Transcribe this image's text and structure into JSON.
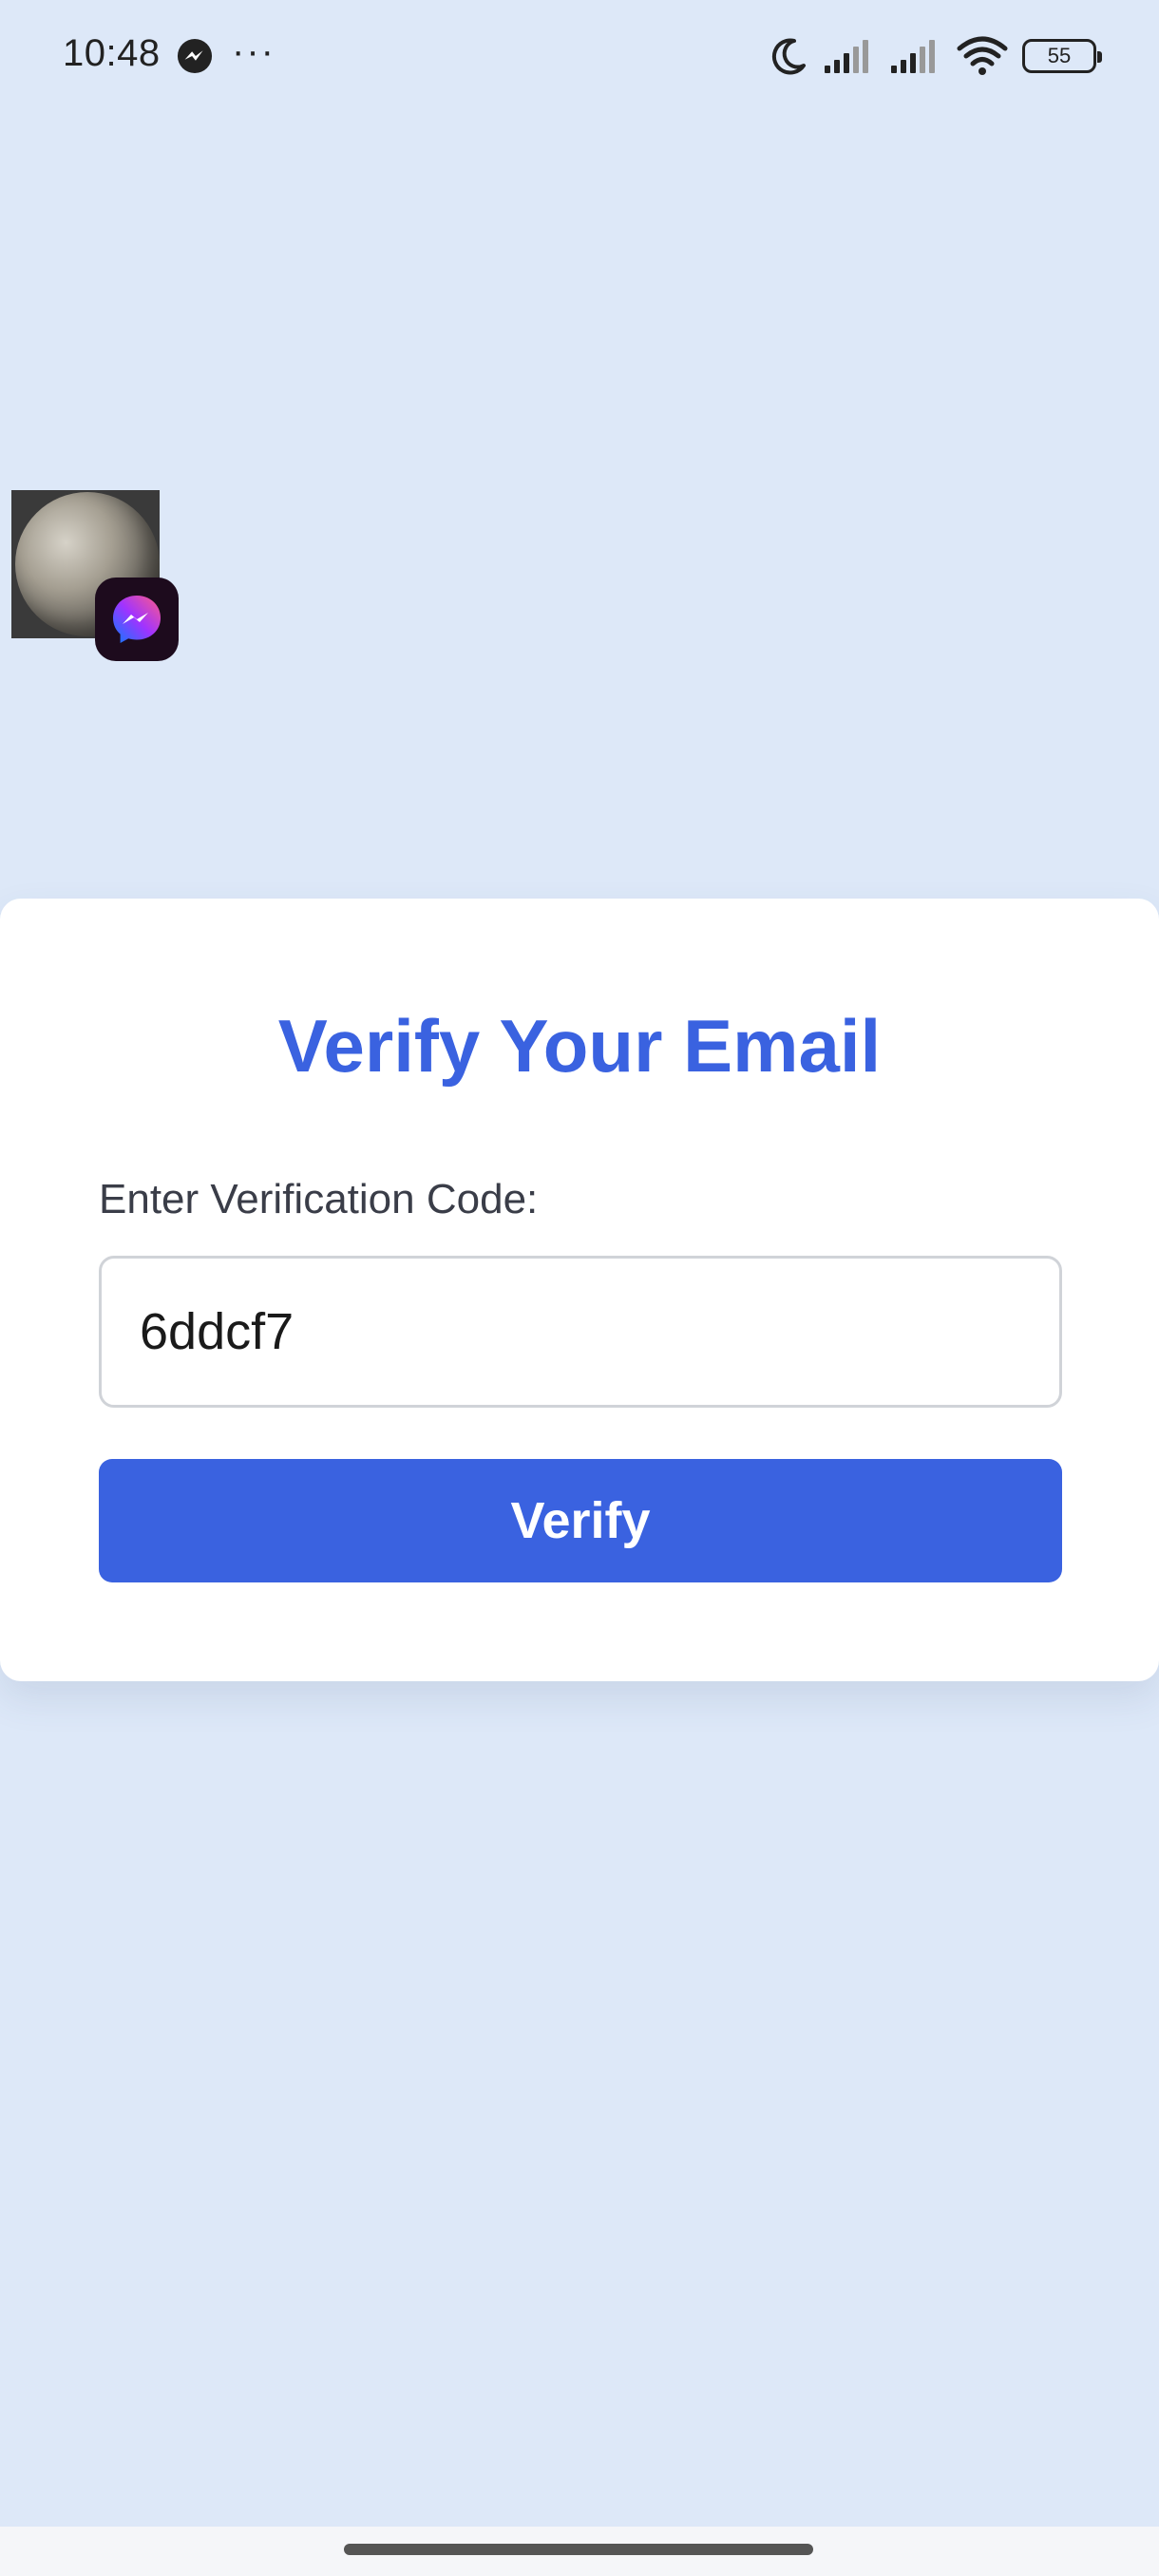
{
  "status_bar": {
    "time": "10:48",
    "more_dots": "···",
    "battery_level": "55",
    "icons": [
      "messenger-icon",
      "moon-icon",
      "signal-icon",
      "signal-icon",
      "wifi-icon",
      "battery-icon"
    ]
  },
  "chat_head": {
    "avatar": "avatar",
    "badge_icon": "messenger-icon"
  },
  "verify": {
    "title": "Verify Your Email",
    "label": "Enter Verification Code:",
    "code_value": "6ddcf7",
    "button_label": "Verify"
  },
  "colors": {
    "background": "#dde8f8",
    "accent": "#3a62e0",
    "card": "#ffffff"
  }
}
